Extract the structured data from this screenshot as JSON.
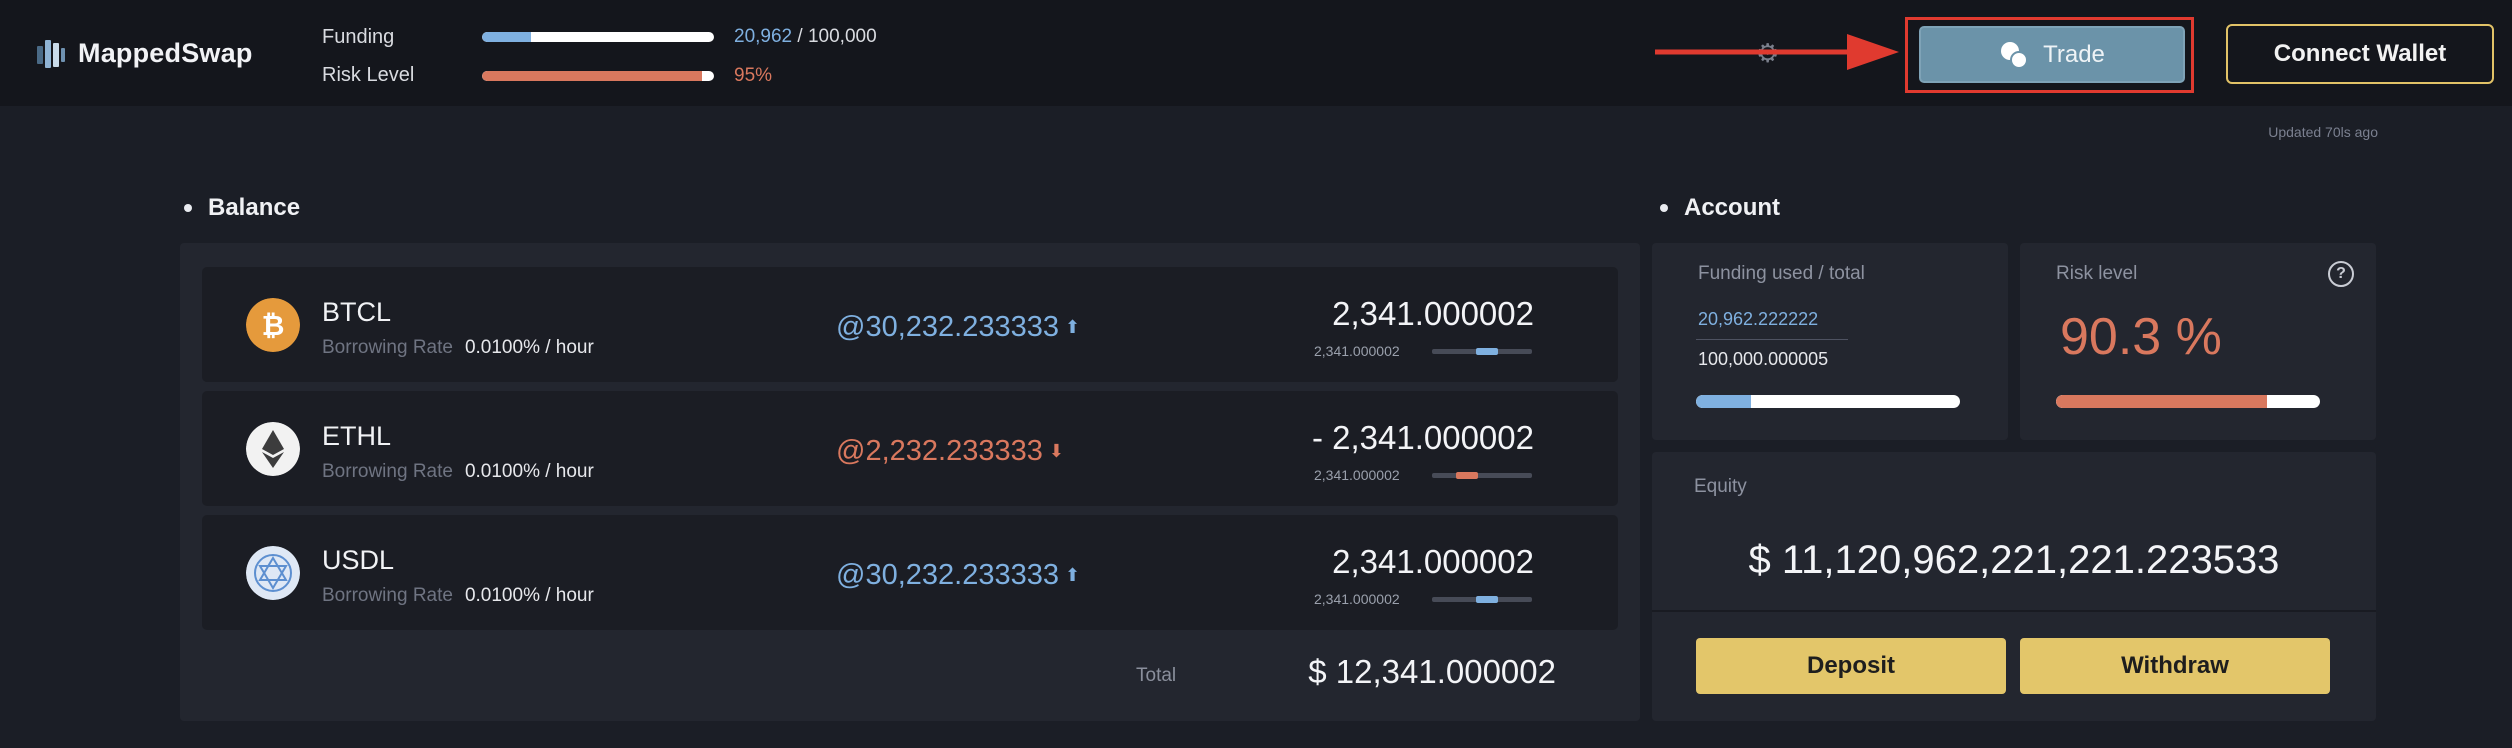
{
  "brand": {
    "name": "MappedSwap"
  },
  "header": {
    "funding": {
      "label": "Funding",
      "used": "20,962",
      "separator": " / ",
      "total": "100,000",
      "fill": 0.21,
      "fill_color": "#7fb0e0"
    },
    "risk": {
      "label": "Risk Level",
      "value": "95%",
      "fill": 0.95,
      "fill_color": "#d9785e"
    },
    "trade_label": "Trade",
    "connect_label": "Connect Wallet",
    "updated": "Updated 70ls ago"
  },
  "balance": {
    "title": "Balance",
    "assets": [
      {
        "name": "BTCL",
        "rate_label": "Borrowing Rate",
        "rate": "0.0100% / hour",
        "price": "@30,232.233333",
        "trend": "up",
        "trend_icon": "⬆",
        "amount": "2,341.000002",
        "amount_sub": "2,341.000002",
        "bar_level": 0.55,
        "icon": "bitcoin-icon",
        "icon_color": "#e59a3c"
      },
      {
        "name": "ETHL",
        "rate_label": "Borrowing Rate",
        "rate": "0.0100% / hour",
        "price": "@2,232.233333",
        "trend": "down",
        "trend_icon": "⬇",
        "amount": "- 2,341.000002",
        "amount_sub": "2,341.000002",
        "bar_level": 0.35,
        "icon": "ethereum-icon",
        "icon_color": "#f2f2f2"
      },
      {
        "name": "USDL",
        "rate_label": "Borrowing Rate",
        "rate": "0.0100% / hour",
        "price": "@30,232.233333",
        "trend": "up",
        "trend_icon": "⬆",
        "amount": "2,341.000002",
        "amount_sub": "2,341.000002",
        "bar_level": 0.55,
        "icon": "usd-coin-icon",
        "icon_color": "#dfe8f5"
      }
    ],
    "total_label": "Total",
    "total_value": "$ 12,341.000002"
  },
  "account": {
    "title": "Account",
    "funding": {
      "label": "Funding used / total",
      "used": "20,962.222222",
      "total": "100,000.000005",
      "fill": 0.21
    },
    "risk": {
      "label": "Risk level",
      "value": "90.3 %",
      "fill": 0.8,
      "help": "?"
    },
    "equity": {
      "label": "Equity",
      "value": "$ 11,120,962,221,221.223533"
    },
    "deposit_label": "Deposit",
    "withdraw_label": "Withdraw"
  },
  "colors": {
    "accent_up": "#7fb0e0",
    "accent_down": "#d9785e",
    "gold": "#e3c66a",
    "trade": "#6b93a9",
    "highlight": "#e03a2f"
  }
}
